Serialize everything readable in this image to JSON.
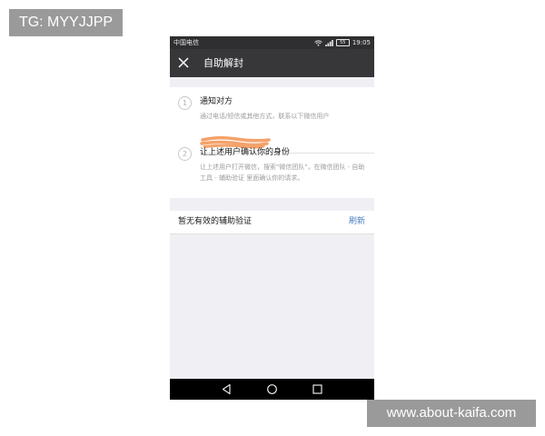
{
  "watermarks": {
    "top_left": "TG: MYYJJPP",
    "bottom_right": "www.about-kaifa.com"
  },
  "status_bar": {
    "carrier": "中国电信",
    "battery": "55",
    "time": "19:05",
    "icons": [
      "wifi-icon",
      "signal-icon",
      "battery-icon"
    ]
  },
  "title_bar": {
    "close_icon": "close-icon",
    "title": "自助解封"
  },
  "steps": [
    {
      "number": "1",
      "title": "通知对方",
      "description": "通过电话/短信或其他方式，联系以下微信用户"
    },
    {
      "number": "2",
      "title": "让上述用户确认你的身份",
      "description": "让上述用户打开微信，搜索\"微信团队\"，在微信团队 - 自助工具 - 辅助验证 里面确认你的请求。"
    }
  ],
  "verify": {
    "label": "暂无有效的辅助验证",
    "refresh": "刷新"
  },
  "nav_bar": {
    "icons": [
      "back-icon",
      "home-icon",
      "recent-apps-icon"
    ]
  },
  "colors": {
    "status_bar": "#2f2f31",
    "title_bar": "#373739",
    "background": "#efeff4",
    "link": "#4a7fc1",
    "redaction": "#f5a26b",
    "watermark": "#9a9a9a"
  }
}
